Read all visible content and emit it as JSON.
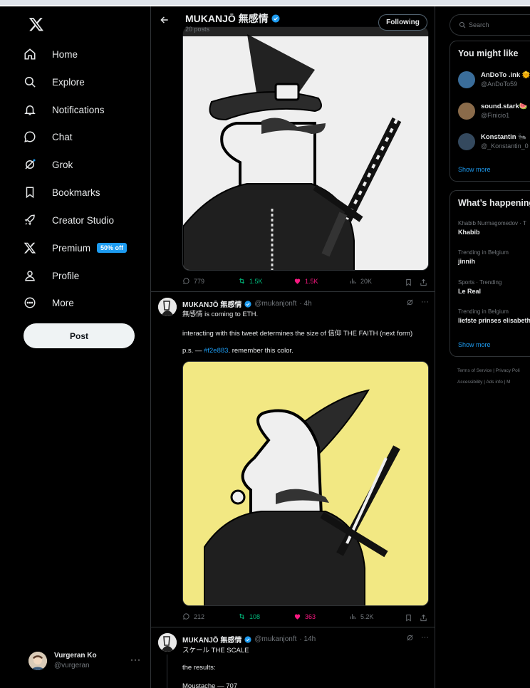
{
  "nav": {
    "items": [
      {
        "label": "Home",
        "icon": "home-icon"
      },
      {
        "label": "Explore",
        "icon": "search-icon"
      },
      {
        "label": "Notifications",
        "icon": "bell-icon"
      },
      {
        "label": "Chat",
        "icon": "chat-bubble-icon"
      },
      {
        "label": "Grok",
        "icon": "grok-icon"
      },
      {
        "label": "Bookmarks",
        "icon": "bookmark-icon"
      },
      {
        "label": "Creator Studio",
        "icon": "rocket-icon"
      },
      {
        "label": "Premium",
        "icon": "x-logo-icon",
        "badge": "50% off"
      },
      {
        "label": "Profile",
        "icon": "person-icon"
      },
      {
        "label": "More",
        "icon": "more-circle-icon"
      }
    ],
    "post_label": "Post"
  },
  "account": {
    "name": "Vurgeran Ko",
    "handle": "@vurgeran"
  },
  "header": {
    "name": "MUKANJŌ 無感情",
    "posts": "20 posts",
    "follow_label": "Following"
  },
  "tweets": [
    {
      "stats": {
        "replies": "779",
        "reposts": "1.5K",
        "likes": "1.5K",
        "views": "20K"
      },
      "image_bg": "#efefef"
    },
    {
      "author": "MUKANJŌ 無感情",
      "handle": "@mukanjonft",
      "time": "· 4h",
      "lines": [
        "無感情 is coming to ETH.",
        "interacting with this tweet determines the size of 信仰 THE FAITH (next form)"
      ],
      "ps_prefix": "p.s. — ",
      "ps_link": "#f2e883",
      "ps_suffix": ". remember this color.",
      "image_bg": "#f2e883",
      "stats": {
        "replies": "212",
        "reposts": "108",
        "likes": "363",
        "views": "5.2K"
      }
    },
    {
      "author": "MUKANJŌ 無感情",
      "handle": "@mukanjonft",
      "time": "· 14h",
      "lines": [
        "スケール THE SCALE",
        "the results:",
        "Moustache — 707"
      ]
    }
  ],
  "right": {
    "search_placeholder": "Search",
    "who_title": "You might like",
    "who": [
      {
        "name": "AnDoTo .ink 🌞",
        "handle": "@AnDoTo59",
        "color": "#3a6d9a"
      },
      {
        "name": "sound.stark🍉",
        "handle": "@Finicio1",
        "color": "#8a6b4a"
      },
      {
        "name": "Konstantin 🐜",
        "handle": "@_Konstantin_0",
        "color": "#34495e"
      }
    ],
    "show_more": "Show more",
    "trends_title": "What’s happening",
    "trends": [
      {
        "meta": "Khabib Nurmagomedov · T",
        "name": "Khabib"
      },
      {
        "meta": "Trending in Belgium",
        "name": "jinnih"
      },
      {
        "meta": "Sports · Trending",
        "name": "Le Real"
      },
      {
        "meta": "Trending in Belgium",
        "name": "liefste prinses elisabeth"
      }
    ],
    "footer_1": "Terms of Service  |  Privacy Poli",
    "footer_2": "Accessibility  |  Ads info  |  M"
  }
}
